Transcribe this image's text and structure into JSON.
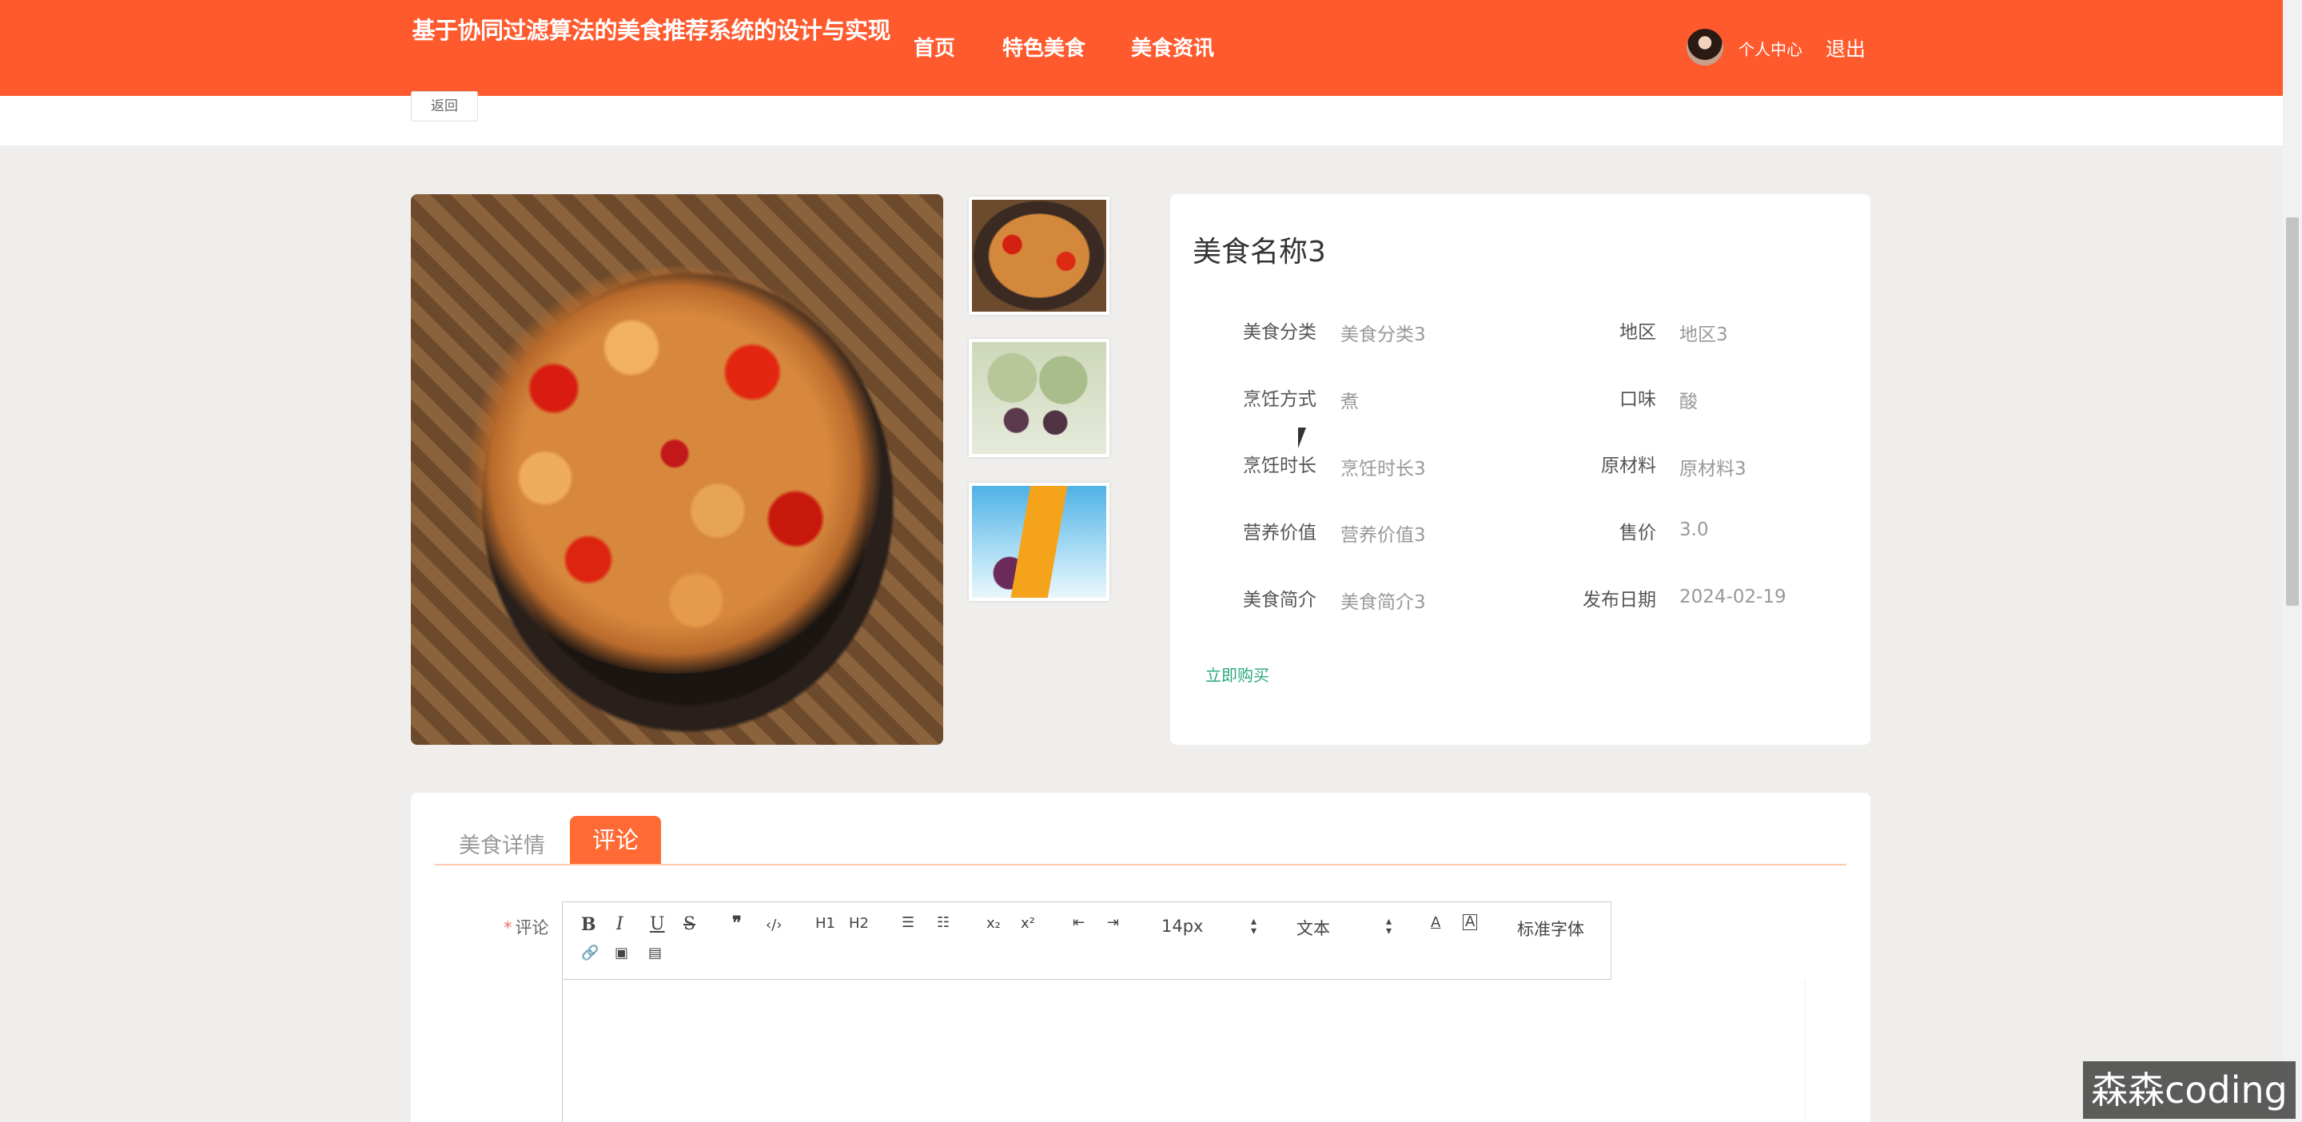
{
  "header": {
    "site_title": "基于协同过滤算法的美食推荐系统的设计与实现",
    "nav": [
      "首页",
      "特色美食",
      "美食资讯"
    ],
    "user_center": "个人中心",
    "logout": "退出"
  },
  "back_label": "返回",
  "food": {
    "name": "美食名称3",
    "fields": [
      {
        "label": "美食分类",
        "value": "美食分类3"
      },
      {
        "label": "地区",
        "value": "地区3"
      },
      {
        "label": "烹饪方式",
        "value": "煮"
      },
      {
        "label": "口味",
        "value": "酸"
      },
      {
        "label": "烹饪时长",
        "value": "烹饪时长3"
      },
      {
        "label": "原材料",
        "value": "原材料3"
      },
      {
        "label": "营养价值",
        "value": "营养价值3"
      },
      {
        "label": "售价",
        "value": "3.0"
      },
      {
        "label": "美食简介",
        "value": "美食简介3"
      },
      {
        "label": "发布日期",
        "value": "2024-02-19"
      }
    ],
    "buy_label": "立即购买"
  },
  "tabs": {
    "detail": "美食详情",
    "comment": "评论",
    "active": "评论"
  },
  "comment": {
    "label": "评论",
    "required_mark": "*"
  },
  "editor": {
    "font_size": "14px",
    "block_type": "文本",
    "font_family": "标准字体",
    "heading1": "H1",
    "heading2": "H2",
    "bold": "B",
    "italic": "I",
    "underline": "U",
    "strike": "S",
    "quote": "❞",
    "code": "‹/›",
    "subscript": "x₂",
    "superscript": "x²",
    "font_color": "A",
    "bg_color": "A"
  },
  "watermark": "森森coding",
  "colors": {
    "header_bg": "#ff5a2e",
    "tab_active": "#ff6a35",
    "buy_link": "#2aa97a",
    "page_bg": "#efeeec"
  },
  "icons": [
    "link-icon",
    "image-icon",
    "video-icon",
    "ordered-list-icon",
    "bullet-list-icon",
    "outdent-icon",
    "indent-icon"
  ]
}
